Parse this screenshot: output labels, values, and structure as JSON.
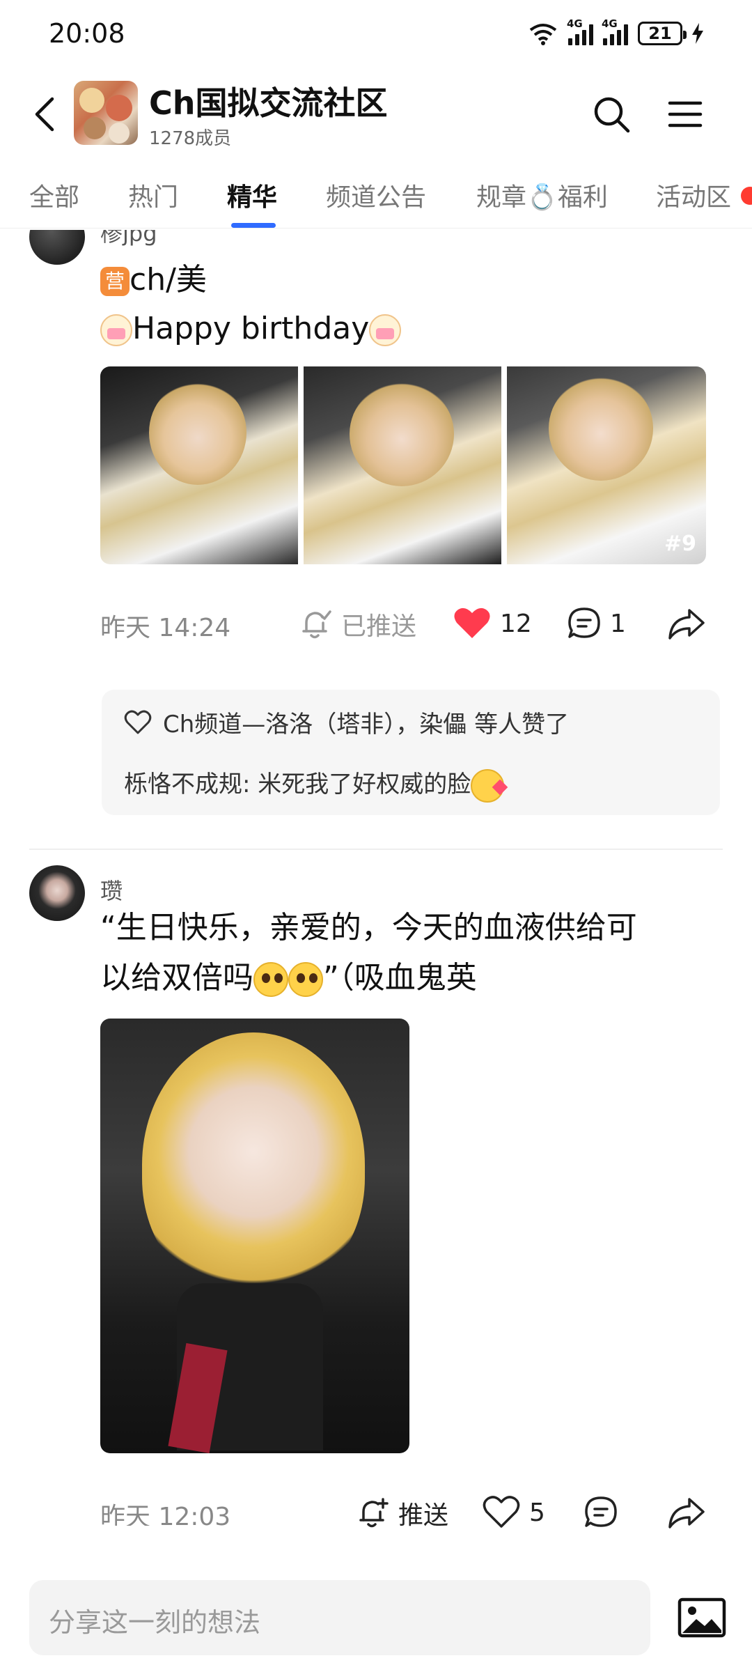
{
  "status_bar": {
    "time": "20:08",
    "signal1": "4G",
    "signal2": "4G",
    "battery": "21"
  },
  "header": {
    "title": "Ch国拟交流社区",
    "members": "1278成员"
  },
  "tabs": [
    {
      "label": "全部",
      "active": false
    },
    {
      "label": "热门",
      "active": false
    },
    {
      "label": "精华",
      "active": true
    },
    {
      "label": "频道公告",
      "active": false
    },
    {
      "label": "规章💍福利",
      "active": false
    },
    {
      "label": "活动区",
      "active": false
    }
  ],
  "posts": [
    {
      "author": "椮jpg",
      "line1": "ch/美",
      "line2": "Happy birthday",
      "image_count_badge": "#9",
      "time": "昨天 14:24",
      "push_label": "已推送",
      "likes": "12",
      "comments": "1",
      "liked": true,
      "like_summary": "Ch频道—洛洛（塔非），染儡 等人赞了",
      "comment_preview": "栎恪不成规: 米死我了好权威的脸"
    },
    {
      "author": "瓒",
      "text_line1": "“生日快乐，亲爱的，今天的血液供给可",
      "text_line2a": "以给双倍吗",
      "text_line2b": "”（吸血鬼英",
      "time": "昨天 12:03",
      "push_label": "推送",
      "likes": "5"
    }
  ],
  "composer": {
    "placeholder": "分享这一刻的想法"
  },
  "colors": {
    "accent": "#2f6bff",
    "like_red": "#ff3b4e",
    "badge_red": "#ff3b30"
  }
}
